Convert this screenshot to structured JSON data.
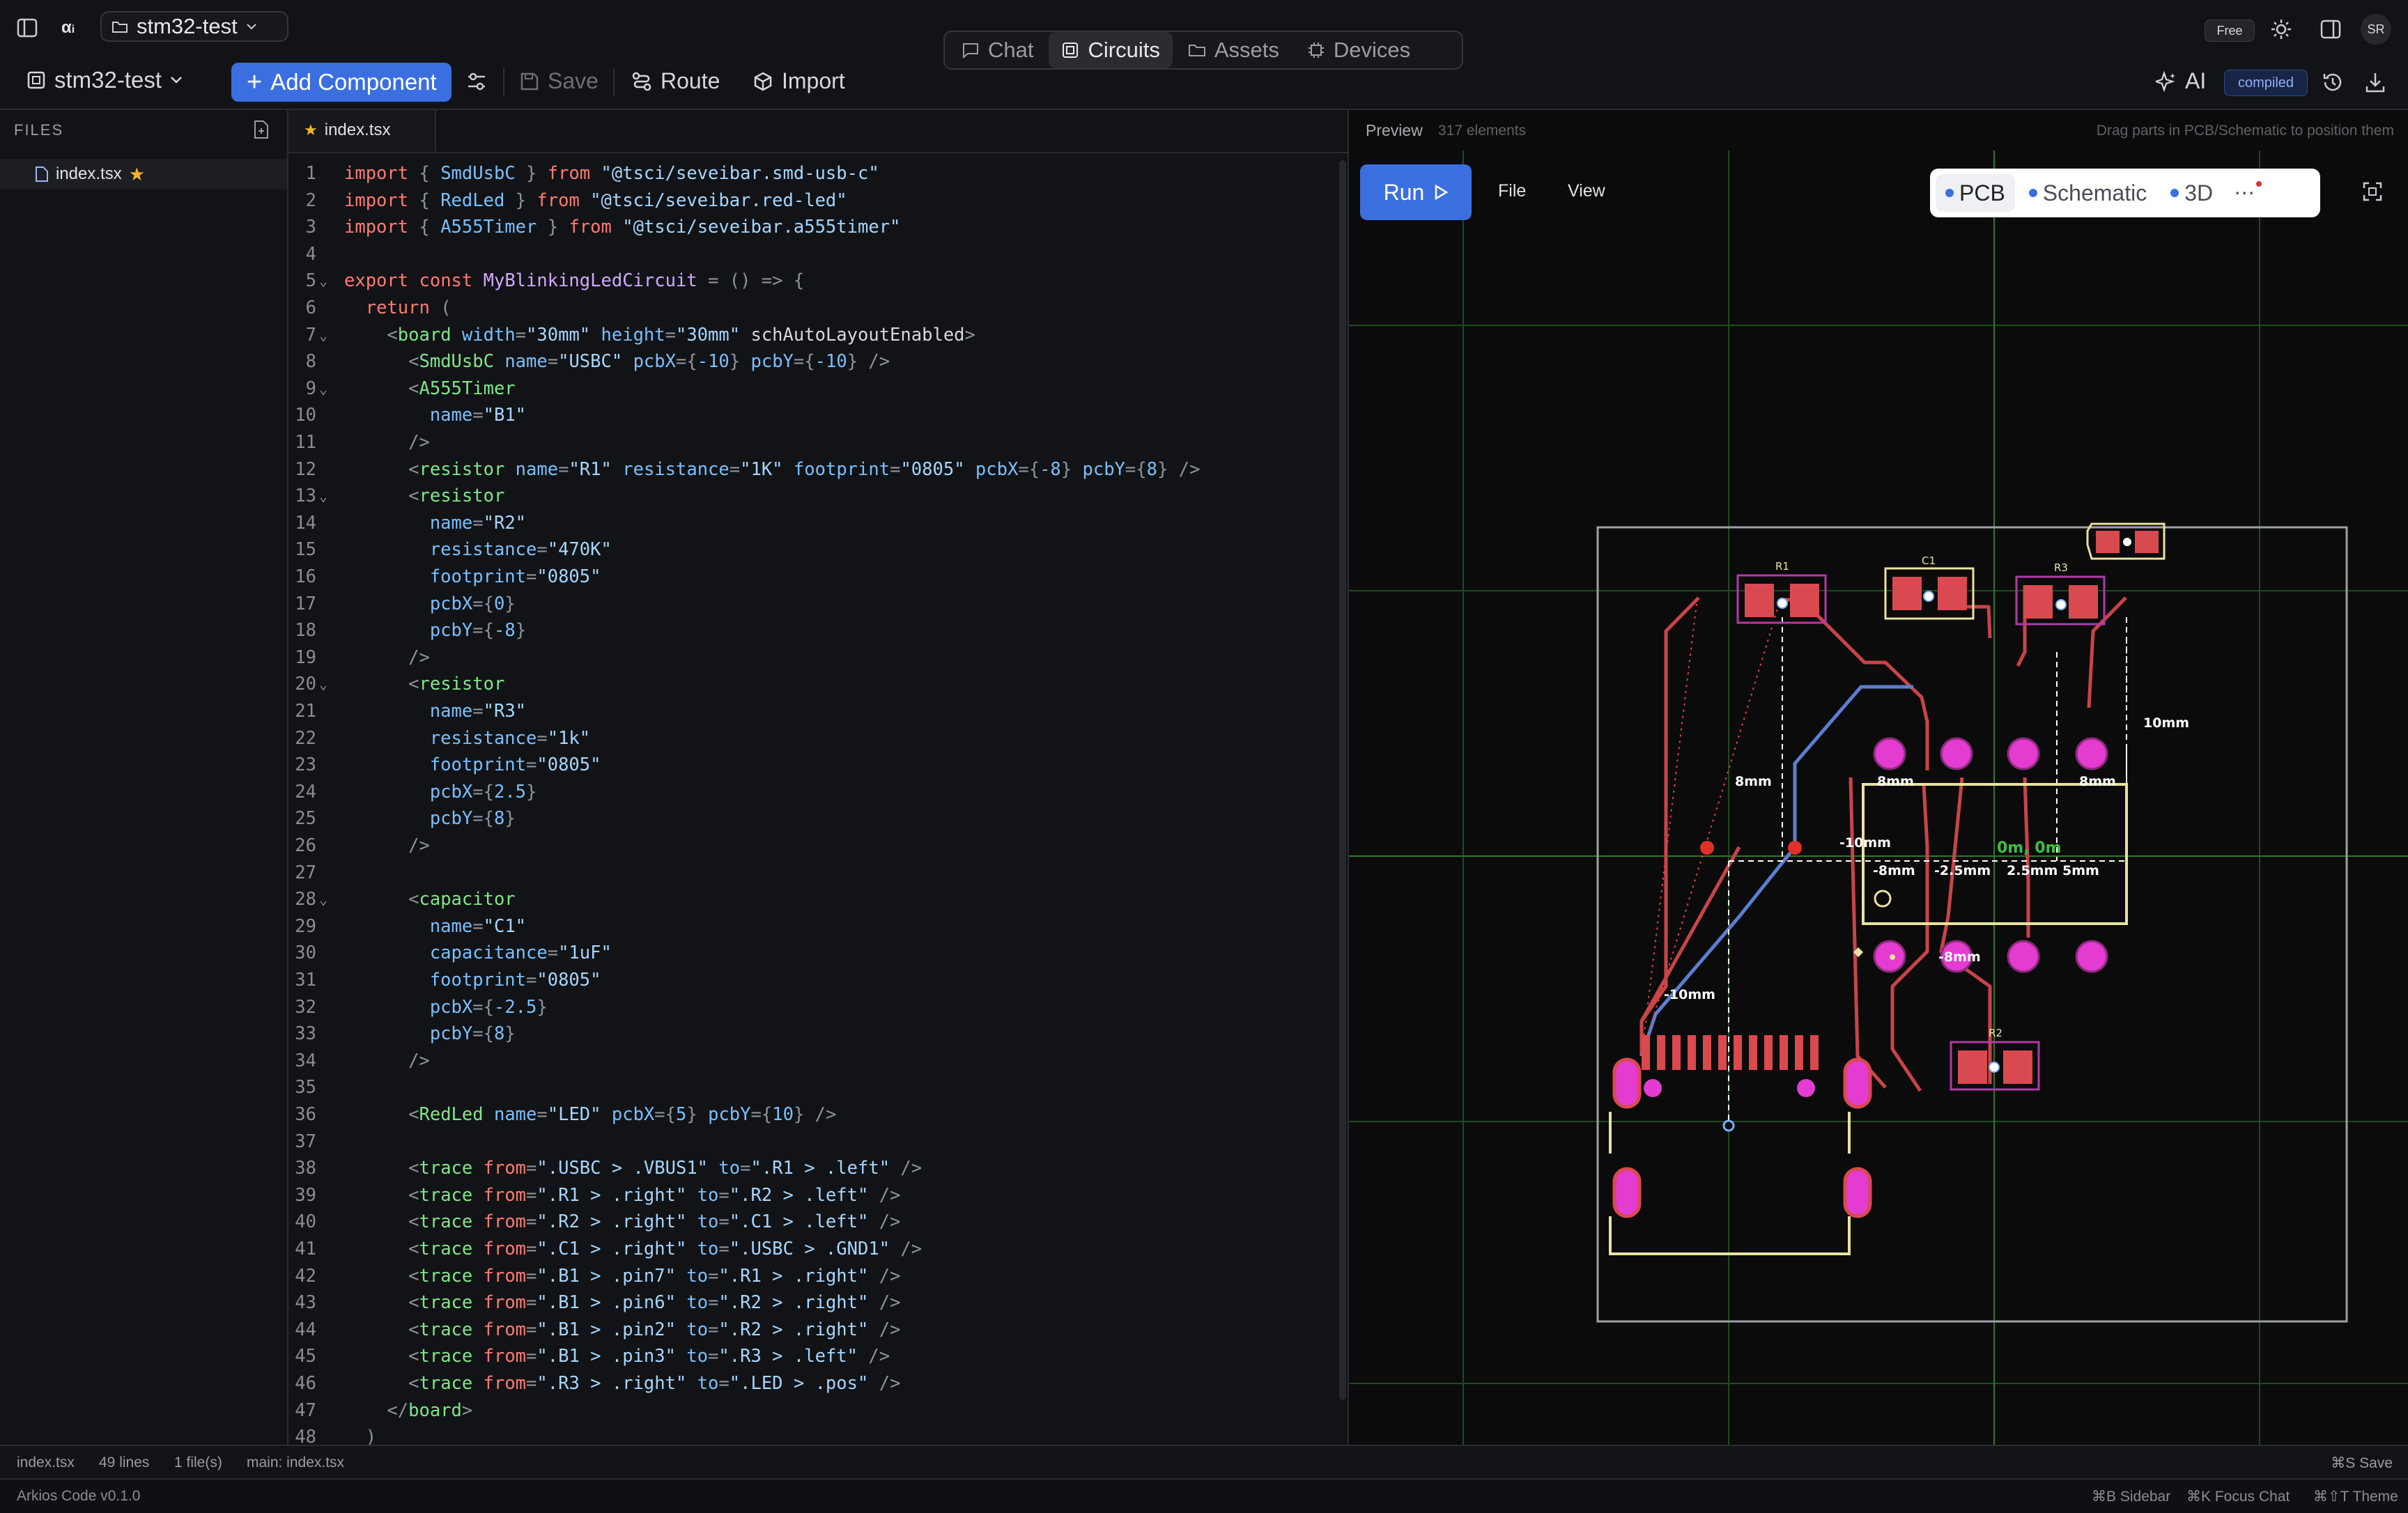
{
  "topbar": {
    "project_name": "stm32-test",
    "plan_badge": "Free",
    "avatar_initials": "SR",
    "nav_tabs": [
      {
        "label": "Chat",
        "icon": "chat-icon",
        "active": false
      },
      {
        "label": "Circuits",
        "icon": "circuit-icon",
        "active": true
      },
      {
        "label": "Assets",
        "icon": "folder-icon",
        "active": false
      },
      {
        "label": "Devices",
        "icon": "chip-icon",
        "active": false
      }
    ]
  },
  "toolbar": {
    "project_select": "stm32-test",
    "add_component_label": "Add Component",
    "save_label": "Save",
    "route_label": "Route",
    "import_label": "Import",
    "ai_label": "AI",
    "compiled_badge": "compiled"
  },
  "sidebar": {
    "heading": "FILES",
    "files": [
      {
        "name": "index.tsx",
        "starred": true
      }
    ]
  },
  "editor": {
    "tab_label": "index.tsx",
    "lines": [
      "import { SmdUsbC } from \"@tsci/seveibar.smd-usb-c\"",
      "import { RedLed } from \"@tsci/seveibar.red-led\"",
      "import { A555Timer } from \"@tsci/seveibar.a555timer\"",
      "",
      "export const MyBlinkingLedCircuit = () => {",
      "  return (",
      "    <board width=\"30mm\" height=\"30mm\" schAutoLayoutEnabled>",
      "      <SmdUsbC name=\"USBC\" pcbX={-10} pcbY={-10} />",
      "      <A555Timer",
      "        name=\"B1\"",
      "      />",
      "      <resistor name=\"R1\" resistance=\"1K\" footprint=\"0805\" pcbX={-8} pcbY={8} />",
      "      <resistor",
      "        name=\"R2\"",
      "        resistance=\"470K\"",
      "        footprint=\"0805\"",
      "        pcbX={0}",
      "        pcbY={-8}",
      "      />",
      "      <resistor",
      "        name=\"R3\"",
      "        resistance=\"1k\"",
      "        footprint=\"0805\"",
      "        pcbX={2.5}",
      "        pcbY={8}",
      "      />",
      "",
      "      <capacitor",
      "        name=\"C1\"",
      "        capacitance=\"1uF\"",
      "        footprint=\"0805\"",
      "        pcbX={-2.5}",
      "        pcbY={8}",
      "      />",
      "",
      "      <RedLed name=\"LED\" pcbX={5} pcbY={10} />",
      "",
      "      <trace from=\".USBC > .VBUS1\" to=\".R1 > .left\" />",
      "      <trace from=\".R1 > .right\" to=\".R2 > .left\" />",
      "      <trace from=\".R2 > .right\" to=\".C1 > .left\" />",
      "      <trace from=\".C1 > .right\" to=\".USBC > .GND1\" />",
      "      <trace from=\".B1 > .pin7\" to=\".R1 > .right\" />",
      "      <trace from=\".B1 > .pin6\" to=\".R2 > .right\" />",
      "      <trace from=\".B1 > .pin2\" to=\".R2 > .right\" />",
      "      <trace from=\".B1 > .pin3\" to=\".R3 > .left\" />",
      "      <trace from=\".R3 > .right\" to=\".LED > .pos\" />",
      "    </board>",
      "  )"
    ],
    "fold_lines": [
      5,
      7,
      9,
      13,
      20,
      28
    ]
  },
  "preview": {
    "title": "Preview",
    "element_count": "317 elements",
    "hint": "Drag parts in PCB/Schematic to position them",
    "run_label": "Run",
    "menu_file": "File",
    "menu_view": "View",
    "view_tabs": [
      {
        "label": "PCB",
        "active": true
      },
      {
        "label": "Schematic",
        "active": false
      },
      {
        "label": "3D",
        "active": false
      }
    ],
    "pcb_labels": {
      "r1": "R1",
      "c1": "C1",
      "r3": "R3",
      "r2": "R2",
      "dim_8mm_a": "8mm",
      "dim_10mm_right": "10mm",
      "pad_8mm_1": "8mm",
      "pad_8mm_2": "8mm",
      "dim_neg10_top": "-10mm",
      "dim_0m": "0m, 0m",
      "dim_neg8": "-8mm",
      "dim_neg25": "-2.5mm",
      "dim_25": "2.5mm",
      "dim_5": "5mm",
      "pad_neg8": "-8mm",
      "dim_neg10_left": "-10mm"
    }
  },
  "statusbar": {
    "file": "index.tsx",
    "lines": "49 lines",
    "files": "1 file(s)",
    "main": "main: index.tsx",
    "save_hint": "⌘S Save"
  },
  "footer": {
    "version": "Arkios Code v0.1.0",
    "sidebar_hint": "⌘B Sidebar",
    "focus_hint": "⌘K Focus Chat",
    "theme_hint": "⌘⇧T Theme"
  },
  "colors": {
    "accent": "#3b6fe0",
    "copper": "#d84a4f",
    "silkscreen": "#e8e2a0",
    "pad_pink": "#e43bd0",
    "trace_blue": "#5b7fd0"
  }
}
